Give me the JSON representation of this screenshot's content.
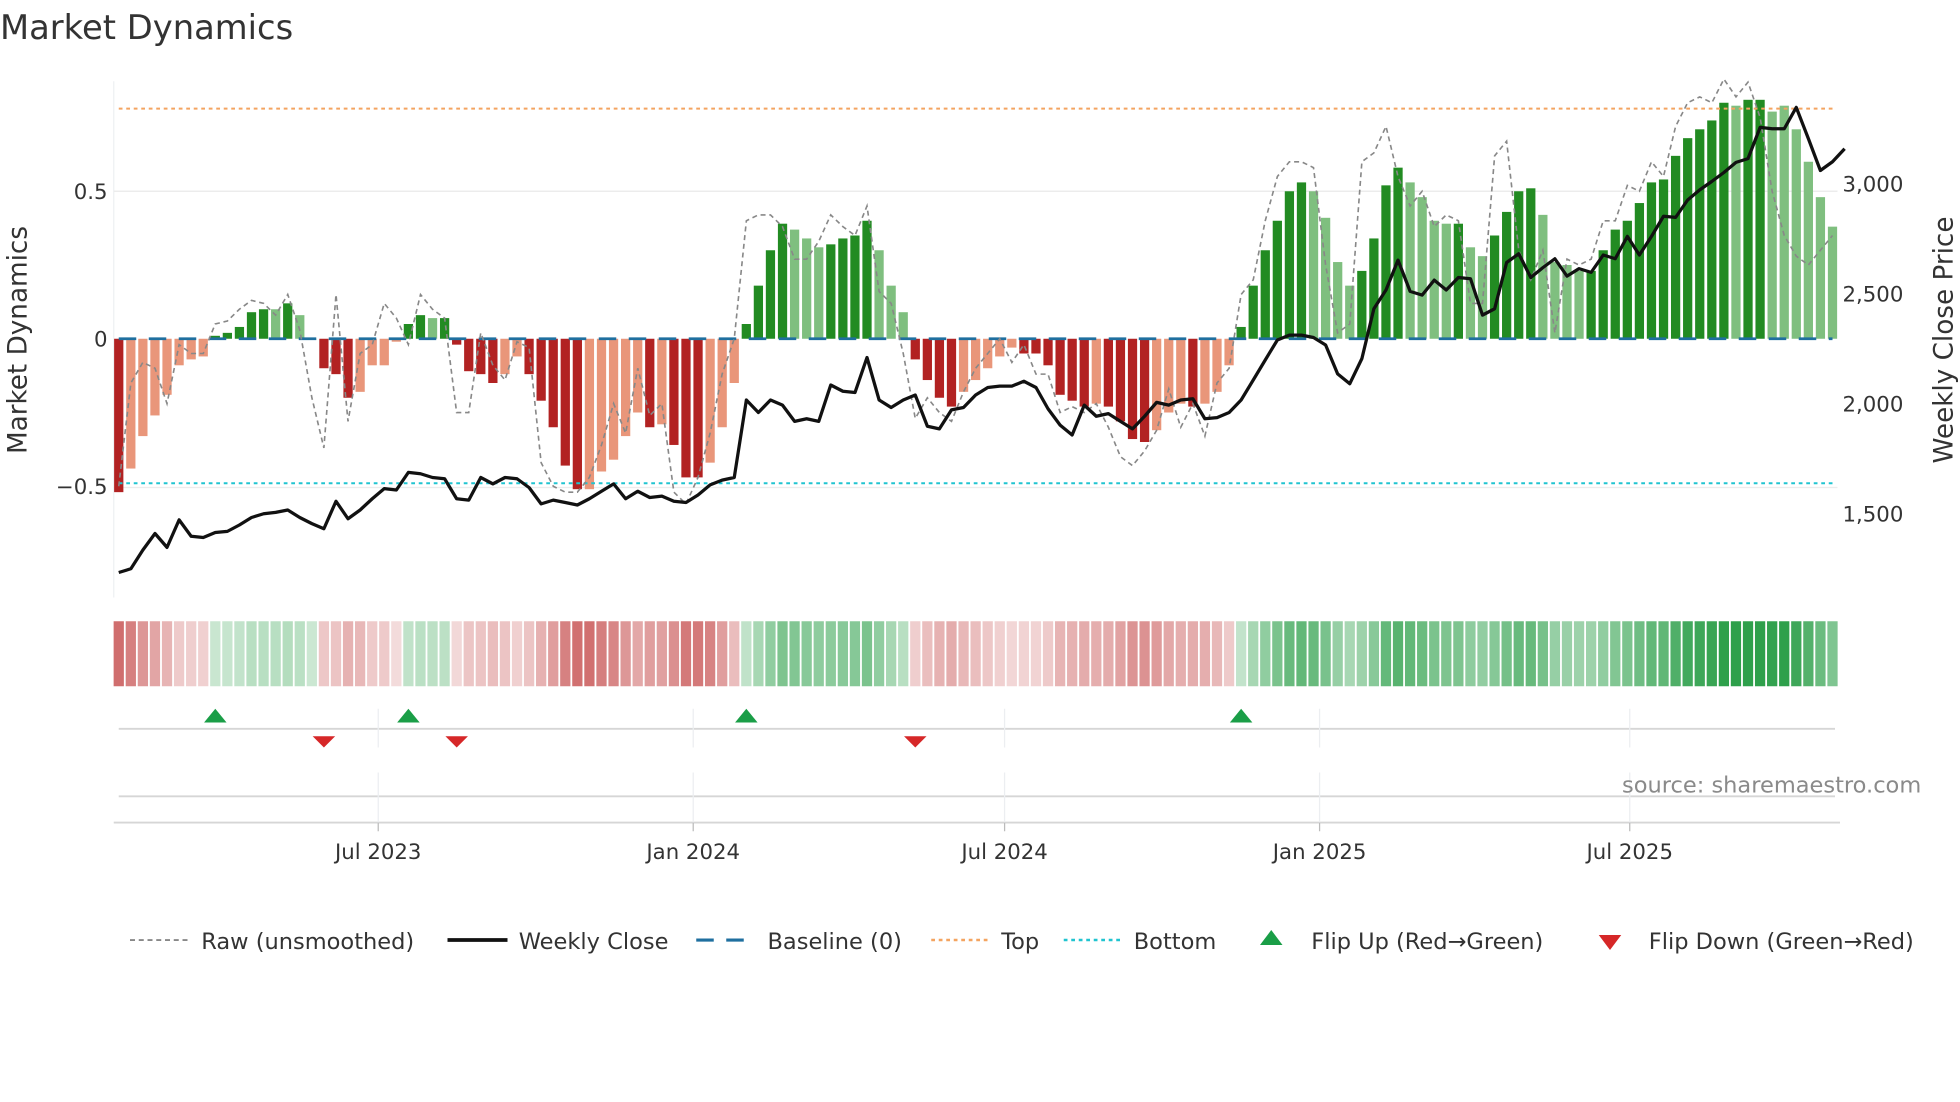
{
  "chart_data": {
    "type": "bar",
    "title": "Market Dynamics",
    "ylabel_left": "Market Dynamics",
    "ylabel_right": "Weekly Close Price",
    "ylim_left": [
      -0.8,
      0.88
    ],
    "ylim_right": [
      1110,
      3780
    ],
    "left_ticks": [
      {
        "value": 0.5,
        "label": "0.5"
      },
      {
        "value": 0,
        "label": "0"
      },
      {
        "value": -0.5,
        "label": "−0.5"
      }
    ],
    "right_ticks": [
      {
        "value": 3000,
        "label": "3,000"
      },
      {
        "value": 2500,
        "label": "2,500"
      },
      {
        "value": 2000,
        "label": "2,000"
      },
      {
        "value": 1500,
        "label": "1,500"
      }
    ],
    "x_unit": "week index",
    "x_ticks": [
      {
        "week": 21.5,
        "label": "Jul 2023"
      },
      {
        "week": 47.6,
        "label": "Jan 2024"
      },
      {
        "week": 73.4,
        "label": "Jul 2024"
      },
      {
        "week": 99.5,
        "label": "Jan 2025"
      },
      {
        "week": 125.2,
        "label": "Jul 2025"
      }
    ],
    "reference_lines": {
      "baseline": 0,
      "top": 0.78,
      "bottom": -0.49
    },
    "colors": {
      "strong_pos": "#228b22",
      "weak_pos": "#7fbf7f",
      "strong_neg": "#b22222",
      "weak_neg": "#e9967a",
      "close": "#111111",
      "raw": "#888888",
      "baseline": "#1f6f9f",
      "top": "#f4a460",
      "bottom": "#20c4d0",
      "flip_up": "#1a9e47",
      "flip_down": "#d62728"
    },
    "smoothed": [
      -0.52,
      -0.44,
      -0.33,
      -0.26,
      -0.19,
      -0.09,
      -0.07,
      -0.06,
      0.01,
      0.02,
      0.04,
      0.09,
      0.1,
      0.1,
      0.12,
      0.08,
      0.0,
      -0.1,
      -0.12,
      -0.2,
      -0.18,
      -0.09,
      -0.09,
      -0.01,
      0.05,
      0.08,
      0.07,
      0.07,
      -0.02,
      -0.11,
      -0.12,
      -0.15,
      -0.12,
      -0.06,
      -0.12,
      -0.21,
      -0.3,
      -0.43,
      -0.51,
      -0.51,
      -0.45,
      -0.41,
      -0.33,
      -0.25,
      -0.3,
      -0.29,
      -0.36,
      -0.47,
      -0.47,
      -0.42,
      -0.3,
      -0.15,
      0.05,
      0.18,
      0.3,
      0.39,
      0.37,
      0.34,
      0.31,
      0.32,
      0.34,
      0.35,
      0.4,
      0.3,
      0.18,
      0.09,
      -0.07,
      -0.14,
      -0.2,
      -0.23,
      -0.18,
      -0.14,
      -0.1,
      -0.06,
      -0.03,
      -0.05,
      -0.05,
      -0.09,
      -0.19,
      -0.21,
      -0.23,
      -0.22,
      -0.23,
      -0.28,
      -0.34,
      -0.35,
      -0.31,
      -0.25,
      -0.22,
      -0.23,
      -0.22,
      -0.18,
      -0.09,
      0.04,
      0.18,
      0.3,
      0.4,
      0.5,
      0.53,
      0.5,
      0.41,
      0.26,
      0.18,
      0.23,
      0.34,
      0.52,
      0.58,
      0.53,
      0.48,
      0.4,
      0.39,
      0.39,
      0.31,
      0.28,
      0.35,
      0.43,
      0.5,
      0.51,
      0.42,
      0.26,
      0.25,
      0.23,
      0.23,
      0.3,
      0.37,
      0.4,
      0.46,
      0.53,
      0.54,
      0.62,
      0.68,
      0.71,
      0.74,
      0.8,
      0.79,
      0.81,
      0.81,
      0.77,
      0.79,
      0.71,
      0.6,
      0.48,
      0.38
    ],
    "strong": [
      1,
      0,
      0,
      0,
      0,
      0,
      0,
      0,
      1,
      1,
      1,
      1,
      1,
      0,
      1,
      0,
      0,
      1,
      1,
      1,
      0,
      0,
      0,
      0,
      1,
      1,
      0,
      1,
      1,
      1,
      1,
      1,
      0,
      0,
      1,
      1,
      1,
      1,
      1,
      0,
      0,
      0,
      0,
      0,
      1,
      0,
      1,
      1,
      1,
      0,
      0,
      0,
      1,
      1,
      1,
      1,
      0,
      0,
      0,
      1,
      1,
      1,
      1,
      0,
      0,
      0,
      1,
      1,
      1,
      1,
      0,
      0,
      0,
      0,
      0,
      1,
      1,
      1,
      1,
      1,
      1,
      0,
      1,
      1,
      1,
      1,
      0,
      0,
      0,
      1,
      0,
      0,
      0,
      1,
      1,
      1,
      1,
      1,
      1,
      0,
      0,
      0,
      0,
      1,
      1,
      1,
      1,
      0,
      0,
      0,
      0,
      1,
      0,
      0,
      1,
      1,
      1,
      1,
      0,
      0,
      0,
      0,
      1,
      1,
      1,
      1,
      1,
      1,
      1,
      1,
      1,
      1,
      1,
      1,
      0,
      1,
      1,
      0,
      0,
      0,
      0,
      0,
      0
    ],
    "raw": [
      -0.5,
      -0.15,
      -0.08,
      -0.1,
      -0.22,
      -0.02,
      -0.05,
      -0.05,
      0.05,
      0.06,
      0.1,
      0.13,
      0.12,
      0.08,
      0.15,
      0.03,
      -0.2,
      -0.37,
      0.15,
      -0.28,
      -0.05,
      -0.02,
      0.12,
      0.07,
      -0.02,
      0.15,
      0.1,
      0.07,
      -0.25,
      -0.25,
      0.02,
      -0.09,
      -0.14,
      -0.01,
      -0.03,
      -0.42,
      -0.5,
      -0.52,
      -0.52,
      -0.47,
      -0.36,
      -0.22,
      -0.32,
      -0.1,
      -0.26,
      -0.22,
      -0.52,
      -0.56,
      -0.47,
      -0.32,
      -0.12,
      0.0,
      0.4,
      0.42,
      0.42,
      0.38,
      0.27,
      0.27,
      0.33,
      0.42,
      0.38,
      0.35,
      0.45,
      0.16,
      0.12,
      -0.05,
      -0.27,
      -0.2,
      -0.25,
      -0.28,
      -0.18,
      -0.1,
      -0.05,
      0.0,
      -0.08,
      -0.02,
      -0.12,
      -0.12,
      -0.25,
      -0.23,
      -0.25,
      -0.22,
      -0.3,
      -0.4,
      -0.43,
      -0.38,
      -0.31,
      -0.17,
      -0.3,
      -0.22,
      -0.33,
      -0.15,
      -0.1,
      0.15,
      0.2,
      0.4,
      0.55,
      0.6,
      0.6,
      0.58,
      0.25,
      0.02,
      0.05,
      0.6,
      0.63,
      0.72,
      0.55,
      0.45,
      0.5,
      0.38,
      0.42,
      0.4,
      0.12,
      0.12,
      0.62,
      0.67,
      0.3,
      0.2,
      0.3,
      0.02,
      0.27,
      0.25,
      0.27,
      0.4,
      0.4,
      0.52,
      0.5,
      0.6,
      0.55,
      0.72,
      0.8,
      0.82,
      0.8,
      0.88,
      0.82,
      0.87,
      0.75,
      0.5,
      0.35,
      0.28,
      0.25,
      0.3,
      0.35
    ],
    "weekly_close": [
      1233,
      1250,
      1335,
      1410,
      1347,
      1472,
      1398,
      1392,
      1415,
      1420,
      1449,
      1483,
      1500,
      1506,
      1517,
      1483,
      1455,
      1432,
      1557,
      1477,
      1517,
      1568,
      1614,
      1608,
      1688,
      1682,
      1665,
      1659,
      1568,
      1562,
      1665,
      1636,
      1665,
      1659,
      1619,
      1545,
      1562,
      1551,
      1540,
      1568,
      1602,
      1636,
      1568,
      1602,
      1574,
      1580,
      1557,
      1551,
      1585,
      1631,
      1653,
      1665,
      2017,
      1960,
      2017,
      1994,
      1920,
      1932,
      1920,
      2085,
      2057,
      2051,
      2210,
      2017,
      1983,
      2017,
      2040,
      1898,
      1886,
      1972,
      1983,
      2040,
      2074,
      2080,
      2080,
      2102,
      2074,
      1977,
      1903,
      1858,
      1994,
      1943,
      1955,
      1920,
      1886,
      1943,
      2006,
      1994,
      2017,
      2023,
      1932,
      1937,
      1960,
      2017,
      2108,
      2199,
      2290,
      2312,
      2312,
      2301,
      2267,
      2136,
      2091,
      2205,
      2432,
      2517,
      2653,
      2511,
      2494,
      2562,
      2517,
      2574,
      2568,
      2403,
      2432,
      2642,
      2682,
      2574,
      2619,
      2659,
      2580,
      2614,
      2597,
      2676,
      2659,
      2761,
      2676,
      2761,
      2852,
      2847,
      2926,
      2972,
      3011,
      3051,
      3097,
      3114,
      3256,
      3250,
      3250,
      3347,
      3205,
      3060,
      3100,
      3159
    ],
    "flip_up_weeks": [
      8,
      24,
      52,
      93
    ],
    "flip_down_weeks": [
      17,
      28,
      66
    ],
    "legend": {
      "position": "bottom",
      "raw": "Raw (unsmoothed)",
      "close": "Weekly Close",
      "baseline": "Baseline (0)",
      "top": "Top",
      "bottom": "Bottom",
      "flip_up": "Flip Up (Red→Green)",
      "flip_down": "Flip Down (Green→Red)"
    },
    "source": "source: sharemaestro.com"
  }
}
